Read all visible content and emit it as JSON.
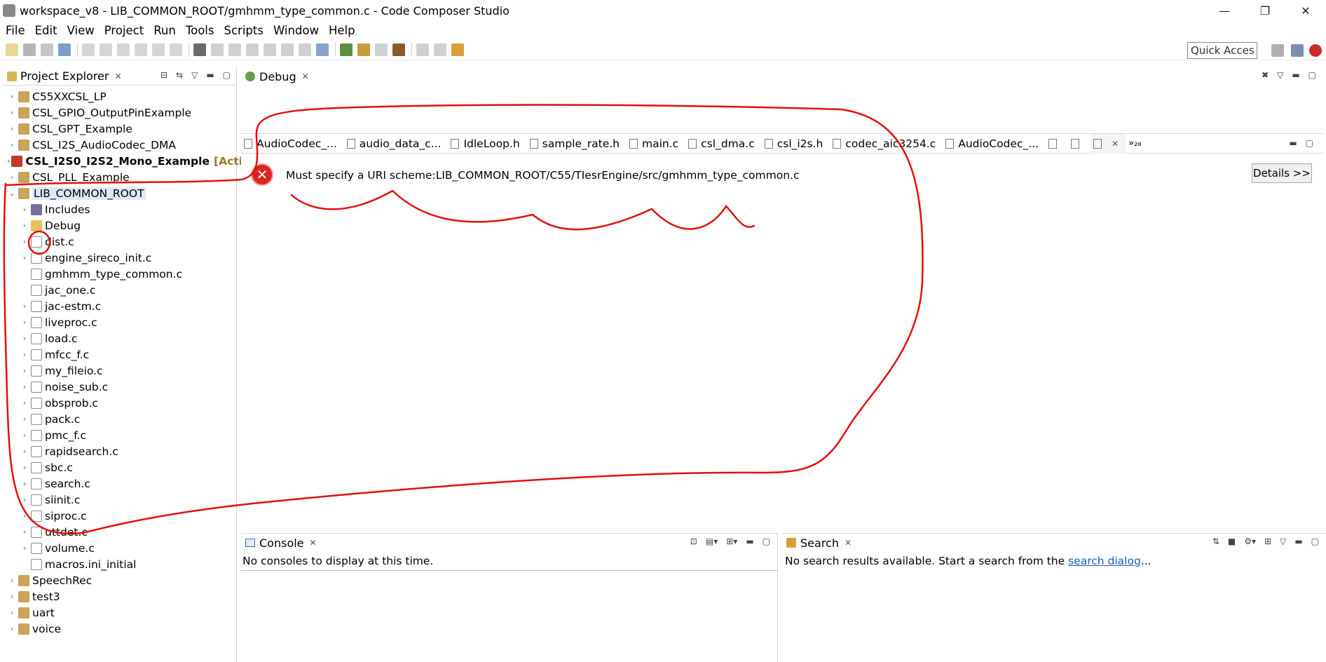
{
  "window": {
    "title": "workspace_v8 - LIB_COMMON_ROOT/gmhmm_type_common.c - Code Composer Studio",
    "minimize": "—",
    "restore": "❐",
    "close": "✕"
  },
  "menu": [
    "File",
    "Edit",
    "View",
    "Project",
    "Run",
    "Tools",
    "Scripts",
    "Window",
    "Help"
  ],
  "toolbar": {
    "quick_access": "Quick Access"
  },
  "project_explorer": {
    "tab_label": "Project Explorer",
    "items": [
      {
        "label": "C55XXCSL_LP",
        "level": 0,
        "icon": "project-icon"
      },
      {
        "label": "CSL_GPIO_OutputPinExample",
        "level": 0,
        "icon": "project-icon"
      },
      {
        "label": "CSL_GPT_Example",
        "level": 0,
        "icon": "project-icon"
      },
      {
        "label": "CSL_I2S_AudioCodec_DMA",
        "level": 0,
        "icon": "project-icon"
      },
      {
        "label": "CSL_I2S0_I2S2_Mono_Example",
        "level": 0,
        "icon": "project-error-icon",
        "bold": true,
        "tag": "[Active"
      },
      {
        "label": "CSL_PLL_Example",
        "level": 0,
        "icon": "project-icon"
      },
      {
        "label": "LIB_COMMON_ROOT",
        "level": 0,
        "icon": "project-icon",
        "expanded": true,
        "selected": true
      },
      {
        "label": "Includes",
        "level": 1,
        "icon": "includes-icon"
      },
      {
        "label": "Debug",
        "level": 1,
        "icon": "folder-icon"
      },
      {
        "label": "dist.c",
        "level": 1,
        "icon": "c-file-icon"
      },
      {
        "label": "engine_sireco_init.c",
        "level": 1,
        "icon": "c-file-icon"
      },
      {
        "label": "gmhmm_type_common.c",
        "level": 1,
        "icon": "c-file-icon",
        "no_twisty": true
      },
      {
        "label": "jac_one.c",
        "level": 1,
        "icon": "c-file-icon",
        "no_twisty": true
      },
      {
        "label": "jac-estm.c",
        "level": 1,
        "icon": "c-file-icon"
      },
      {
        "label": "liveproc.c",
        "level": 1,
        "icon": "c-file-icon"
      },
      {
        "label": "load.c",
        "level": 1,
        "icon": "c-file-icon"
      },
      {
        "label": "mfcc_f.c",
        "level": 1,
        "icon": "c-file-icon"
      },
      {
        "label": "my_fileio.c",
        "level": 1,
        "icon": "c-file-icon"
      },
      {
        "label": "noise_sub.c",
        "level": 1,
        "icon": "c-file-icon"
      },
      {
        "label": "obsprob.c",
        "level": 1,
        "icon": "c-file-icon"
      },
      {
        "label": "pack.c",
        "level": 1,
        "icon": "c-file-icon"
      },
      {
        "label": "pmc_f.c",
        "level": 1,
        "icon": "c-file-icon"
      },
      {
        "label": "rapidsearch.c",
        "level": 1,
        "icon": "c-file-icon"
      },
      {
        "label": "sbc.c",
        "level": 1,
        "icon": "c-file-icon"
      },
      {
        "label": "search.c",
        "level": 1,
        "icon": "c-file-icon"
      },
      {
        "label": "siinit.c",
        "level": 1,
        "icon": "c-file-icon"
      },
      {
        "label": "siproc.c",
        "level": 1,
        "icon": "c-file-icon"
      },
      {
        "label": "uttdet.c",
        "level": 1,
        "icon": "c-file-icon"
      },
      {
        "label": "volume.c",
        "level": 1,
        "icon": "c-file-icon"
      },
      {
        "label": "macros.ini_initial",
        "level": 1,
        "icon": "text-file-icon",
        "no_twisty": true
      },
      {
        "label": "SpeechRec",
        "level": 0,
        "icon": "project-icon"
      },
      {
        "label": "test3",
        "level": 0,
        "icon": "project-icon"
      },
      {
        "label": "uart",
        "level": 0,
        "icon": "project-icon"
      },
      {
        "label": "voice",
        "level": 0,
        "icon": "project-icon"
      }
    ]
  },
  "debug_view": {
    "tab_label": "Debug"
  },
  "editor": {
    "tabs": [
      {
        "label": "AudioCodec_..."
      },
      {
        "label": "audio_data_c..."
      },
      {
        "label": "IdleLoop.h"
      },
      {
        "label": "sample_rate.h"
      },
      {
        "label": "main.c"
      },
      {
        "label": "csl_dma.c"
      },
      {
        "label": "csl_i2s.h"
      },
      {
        "label": "codec_aic3254.c"
      },
      {
        "label": "AudioCodec_..."
      },
      {
        "label": ""
      },
      {
        "label": ""
      },
      {
        "label": "",
        "active": true
      }
    ],
    "overflow": "»₂₈",
    "error_message": "Must specify a URI scheme:LIB_COMMON_ROOT/C55/TIesrEngine/src/gmhmm_type_common.c",
    "details_button": "Details >>"
  },
  "console_view": {
    "tab_label": "Console",
    "message": "No consoles to display at this time."
  },
  "search_view": {
    "tab_label": "Search",
    "message": "No search results available. Start a search from the ",
    "link": "search dialog",
    "suffix": "..."
  },
  "colors": {
    "annotation": "#e01010",
    "selection": "#dbe9f7",
    "link": "#1a5fb4"
  }
}
